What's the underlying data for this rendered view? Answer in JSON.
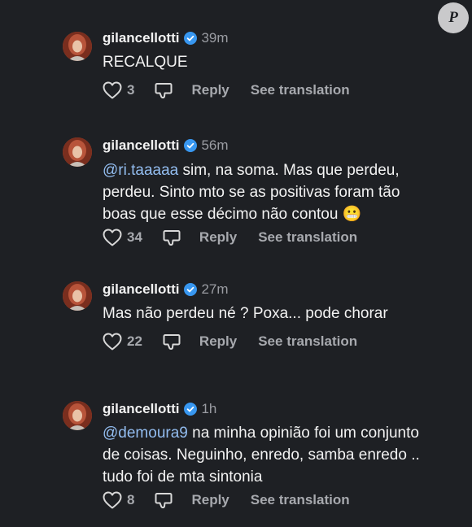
{
  "watermark": {
    "letter": "P"
  },
  "labels": {
    "reply": "Reply",
    "see_translation": "See translation"
  },
  "colors": {
    "background": "#1e2024",
    "mention": "#93bdf0",
    "verified": "#3897f0",
    "secondary_text": "#9a9ca2"
  },
  "icons": [
    "heart-icon",
    "dislike-icon",
    "verified-badge-icon"
  ],
  "comments": [
    {
      "username": "gilancellotti",
      "time": "39m",
      "text": "RECALQUE",
      "likes": "3"
    },
    {
      "username": "gilancellotti",
      "time": "56m",
      "mention": "@ri.taaaaa",
      "text_line1": " sim, na soma. Mas que perdeu,",
      "text_line2": "perdeu. Sinto mto se as positivas foram tão",
      "text_line3": "boas que esse décimo não contou 😬",
      "likes": "34"
    },
    {
      "username": "gilancellotti",
      "time": "27m",
      "text": "Mas não perdeu né ? Poxa... pode chorar",
      "likes": "22"
    },
    {
      "username": "gilancellotti",
      "time": "1h",
      "mention": "@demoura9",
      "text_line1": " na minha opinião foi um conjunto",
      "text_line2": "de coisas. Neguinho, enredo, samba enredo ..",
      "text_line3": "tudo foi de mta sintonia",
      "likes": "8"
    }
  ]
}
